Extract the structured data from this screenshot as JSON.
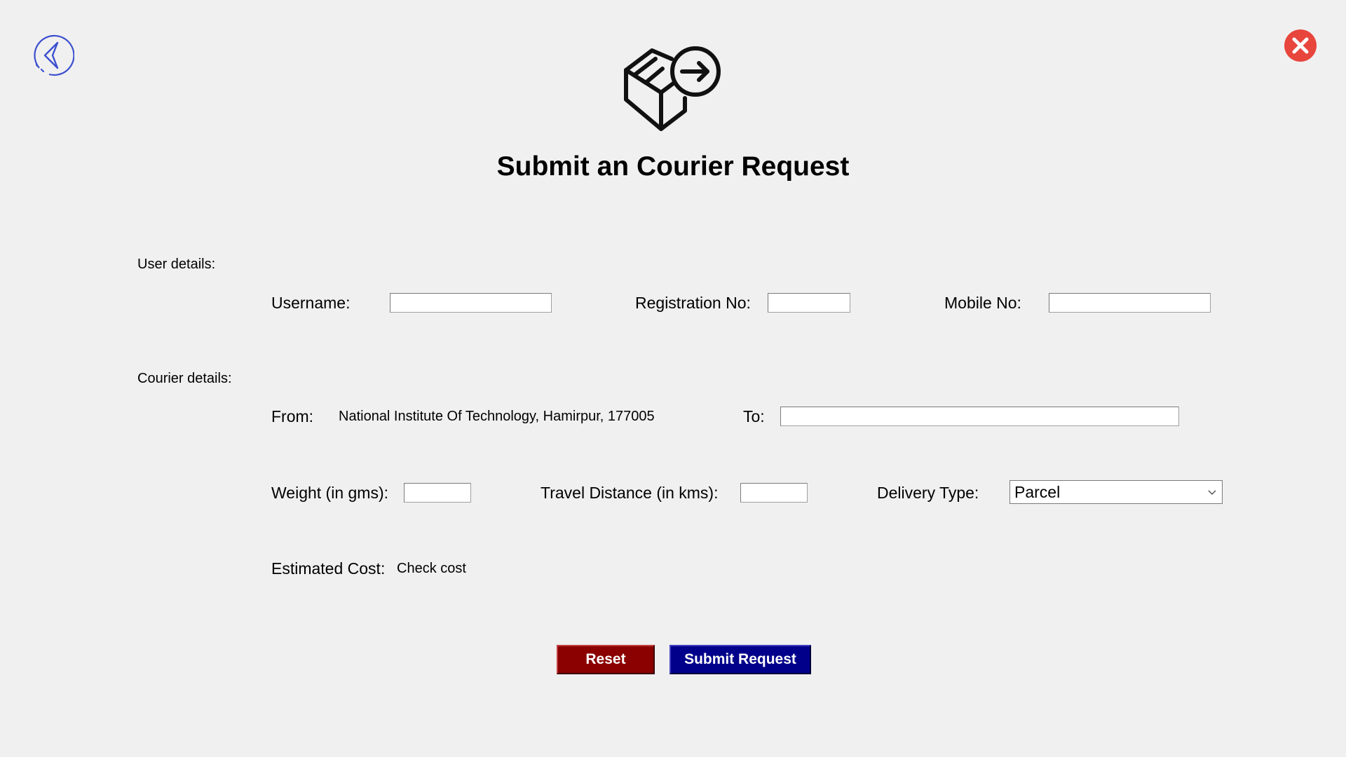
{
  "title": "Submit an Courier Request",
  "sections": {
    "user": "User details:",
    "courier": "Courier details:"
  },
  "fields": {
    "username": {
      "label": "Username:",
      "value": ""
    },
    "registration_no": {
      "label": "Registration No:",
      "value": ""
    },
    "mobile_no": {
      "label": "Mobile No:",
      "value": ""
    },
    "from": {
      "label": "From:",
      "value": "National Institute Of Technology, Hamirpur, 177005"
    },
    "to": {
      "label": "To:",
      "value": ""
    },
    "weight": {
      "label": "Weight (in gms):",
      "value": ""
    },
    "distance": {
      "label": "Travel Distance (in kms):",
      "value": ""
    },
    "delivery_type": {
      "label": "Delivery Type:",
      "selected": "Parcel"
    },
    "estimated_cost": {
      "label": "Estimated Cost:",
      "value": "Check cost"
    }
  },
  "buttons": {
    "reset": "Reset",
    "submit": "Submit Request"
  },
  "icons": {
    "back": "back-arrow-icon",
    "close": "close-icon",
    "logo": "package-send-icon"
  },
  "colors": {
    "background": "#f0f0f0",
    "reset_button": "#8b0000",
    "submit_button": "#00008b",
    "close_icon": "#e8453c",
    "back_icon": "#3b4fcf"
  }
}
